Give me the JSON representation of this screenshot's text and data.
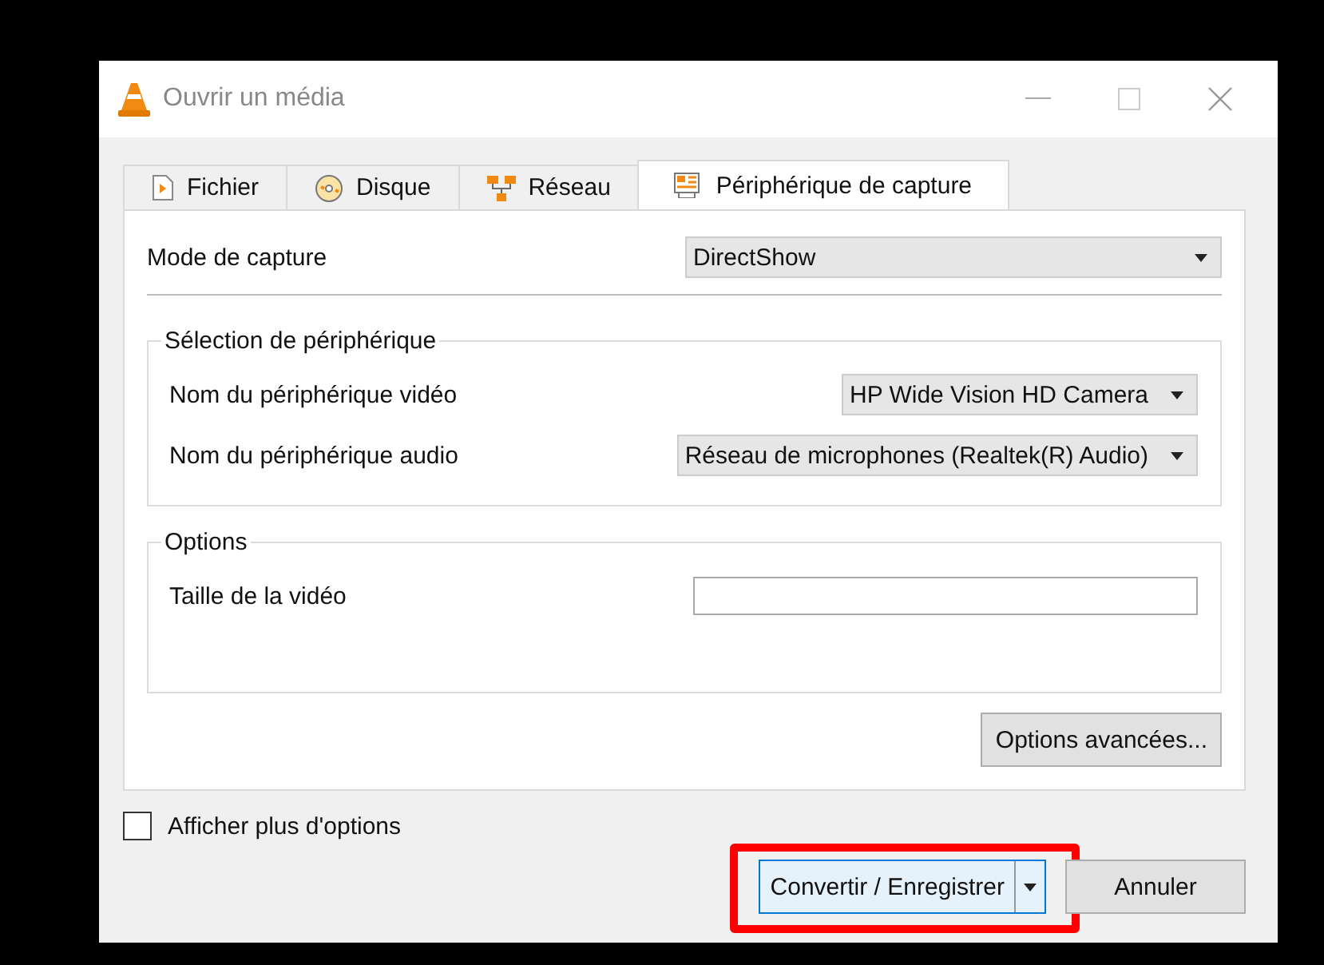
{
  "window": {
    "title": "Ouvrir un média"
  },
  "tabs": [
    {
      "label": "Fichier",
      "kind": "file",
      "selected": false
    },
    {
      "label": "Disque",
      "kind": "disc",
      "selected": false
    },
    {
      "label": "Réseau",
      "kind": "network",
      "selected": false
    },
    {
      "label": "Périphérique de capture",
      "kind": "capture",
      "selected": true
    }
  ],
  "capture_mode": {
    "label": "Mode de capture",
    "value": "DirectShow"
  },
  "device_selection": {
    "title": "Sélection de périphérique",
    "rows": [
      {
        "label": "Nom du périphérique vidéo",
        "value": "HP Wide Vision HD Camera"
      },
      {
        "label": "Nom du périphérique audio",
        "value": "Réseau de microphones (Realtek(R) Audio)"
      }
    ]
  },
  "options": {
    "title": "Options",
    "video_size_label": "Taille de la vidéo"
  },
  "advanced_button": "Options avancées...",
  "show_more": {
    "label": "Afficher plus d'options",
    "checked": false
  },
  "buttons": [
    {
      "label": "Convertir / Enregistrer",
      "kind": "split",
      "highlighted": true
    },
    {
      "label": "Annuler",
      "kind": "plain",
      "highlighted": false
    }
  ]
}
